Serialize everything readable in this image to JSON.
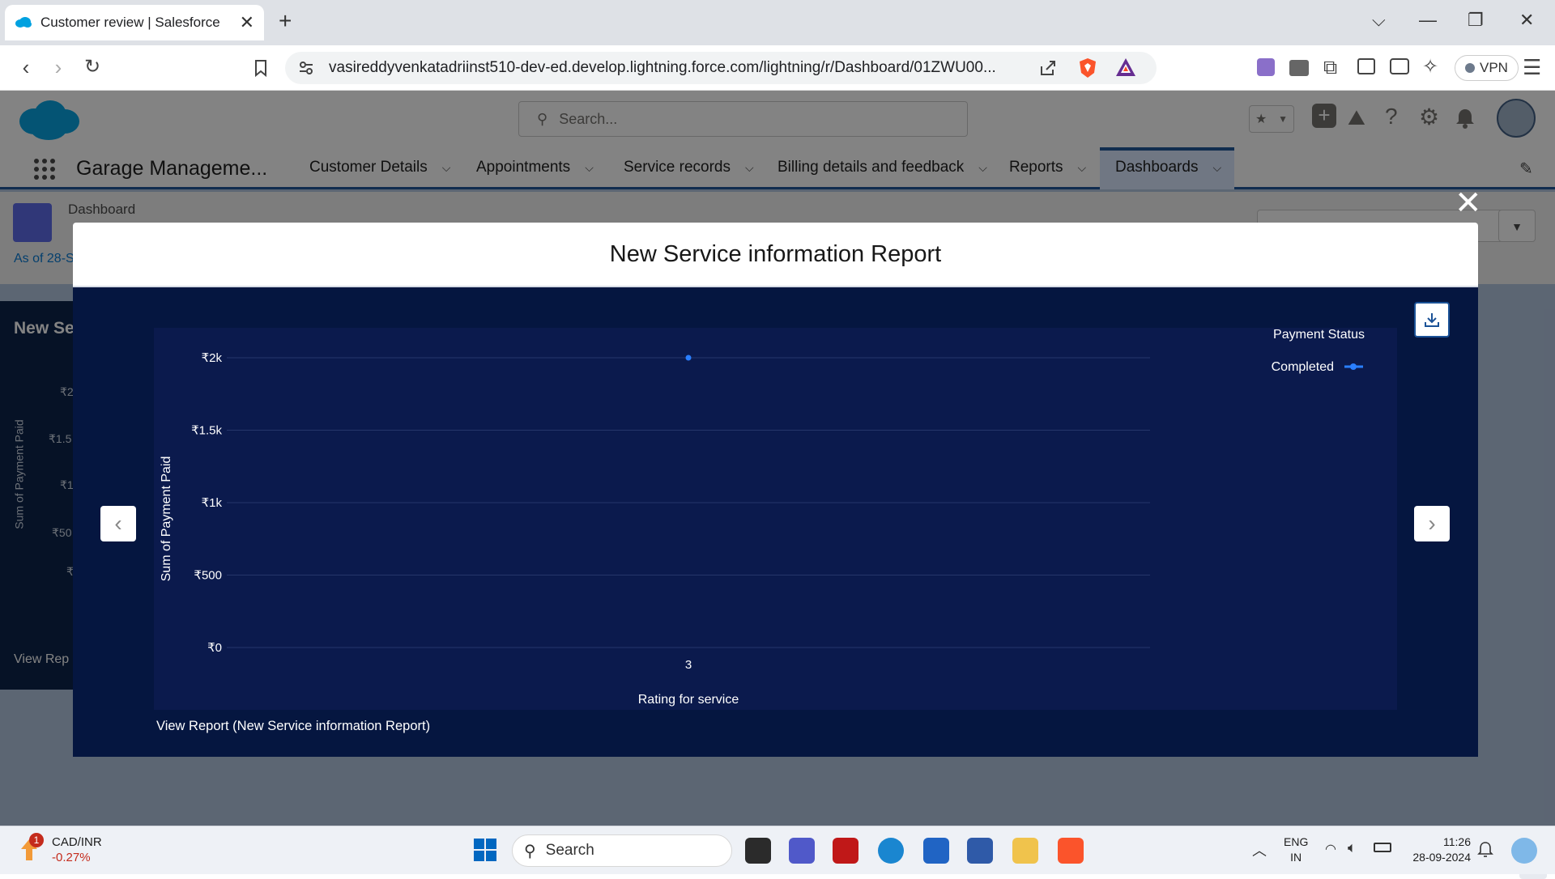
{
  "browser": {
    "tab_title": "Customer review | Salesforce",
    "new_tab": "+",
    "url": "vasireddyvenkatadriinst510-dev-ed.develop.lightning.force.com/lightning/r/Dashboard/01ZWU00...",
    "vpn_label": "VPN"
  },
  "sf": {
    "search_placeholder": "Search...",
    "app_name": "Garage Manageme...",
    "nav_items": [
      "Customer Details",
      "Appointments",
      "Service records",
      "Billing details and feedback",
      "Reports",
      "Dashboards"
    ],
    "active_nav": "Dashboards",
    "dashboard_label": "Dashboard",
    "as_of": "As of 28-S",
    "bg_panel_title": "New Se",
    "bg_panel_ylabel": "Sum of Payment Paid",
    "bg_panel_ticks": [
      "₹2",
      "₹1.5",
      "₹1",
      "₹50",
      "₹"
    ],
    "bg_view_report": "View Rep"
  },
  "modal": {
    "title": "New Service information Report",
    "view_report_link": "View Report (New Service information Report)"
  },
  "chart_data": {
    "type": "line",
    "x": [
      "3"
    ],
    "series": [
      {
        "name": "Completed",
        "values": [
          2000
        ]
      }
    ],
    "xlabel": "Rating for service",
    "ylabel": "Sum of Payment Paid",
    "legend_title": "Payment Status",
    "legend_position": "top-right",
    "y_ticks": [
      0,
      500,
      1000,
      1500,
      2000
    ],
    "y_tick_labels": [
      "₹0",
      "₹500",
      "₹1k",
      "₹1.5k",
      "₹2k"
    ],
    "ylim": [
      0,
      2000
    ],
    "grid": true,
    "series_color": "#2a7fff"
  },
  "taskbar": {
    "ticker_name": "CAD/INR",
    "ticker_change": "-0.27%",
    "ticker_badge": "1",
    "search_label": "Search",
    "lang_top": "ENG",
    "lang_bottom": "IN",
    "time": "11:26",
    "date": "28-09-2024"
  }
}
